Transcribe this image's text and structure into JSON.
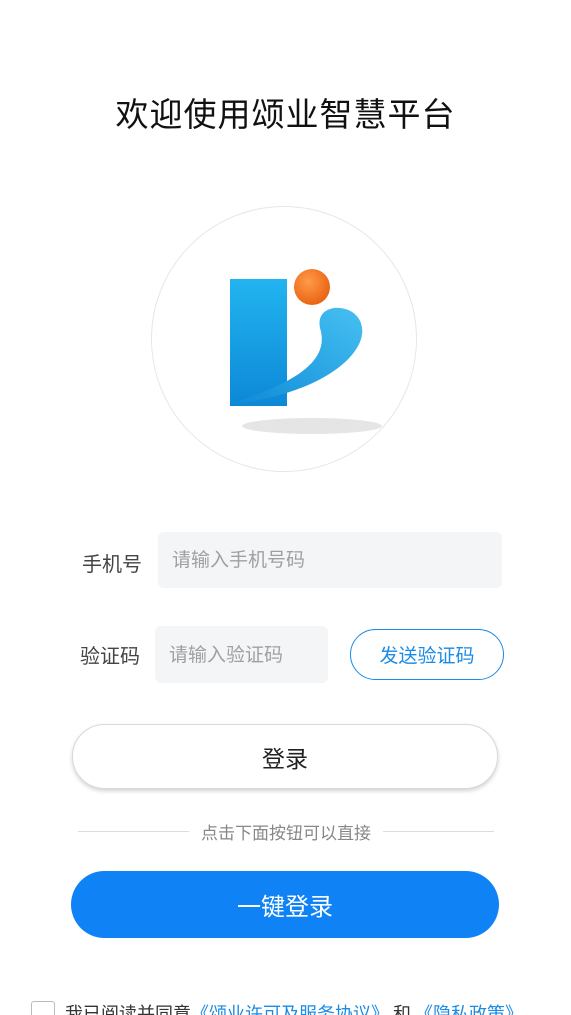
{
  "header": {
    "title": "欢迎使用颂业智慧平台"
  },
  "logo": {
    "icon": "brand-logo-icon",
    "colors": {
      "bar": "#1aa5e8",
      "swoosh": "#2aa8e0",
      "dot": "#f2731e"
    }
  },
  "form": {
    "phone": {
      "label": "手机号",
      "placeholder": "请输入手机号码",
      "value": ""
    },
    "code": {
      "label": "验证码",
      "placeholder": "请输入验证码",
      "value": ""
    },
    "send_code_label": "发送验证码",
    "login_label": "登录"
  },
  "quick_login": {
    "hint": "点击下面按钮可以直接",
    "button_label": "一键登录"
  },
  "agreement": {
    "prefix": "我已阅读并同意",
    "service_link": "《颂业许可及服务协议》",
    "joiner": "和",
    "privacy_link": "《隐私政策》",
    "checked": false
  },
  "colors": {
    "accent": "#0f83f5",
    "link": "#1a8be6",
    "input_bg": "#f4f5f7"
  }
}
